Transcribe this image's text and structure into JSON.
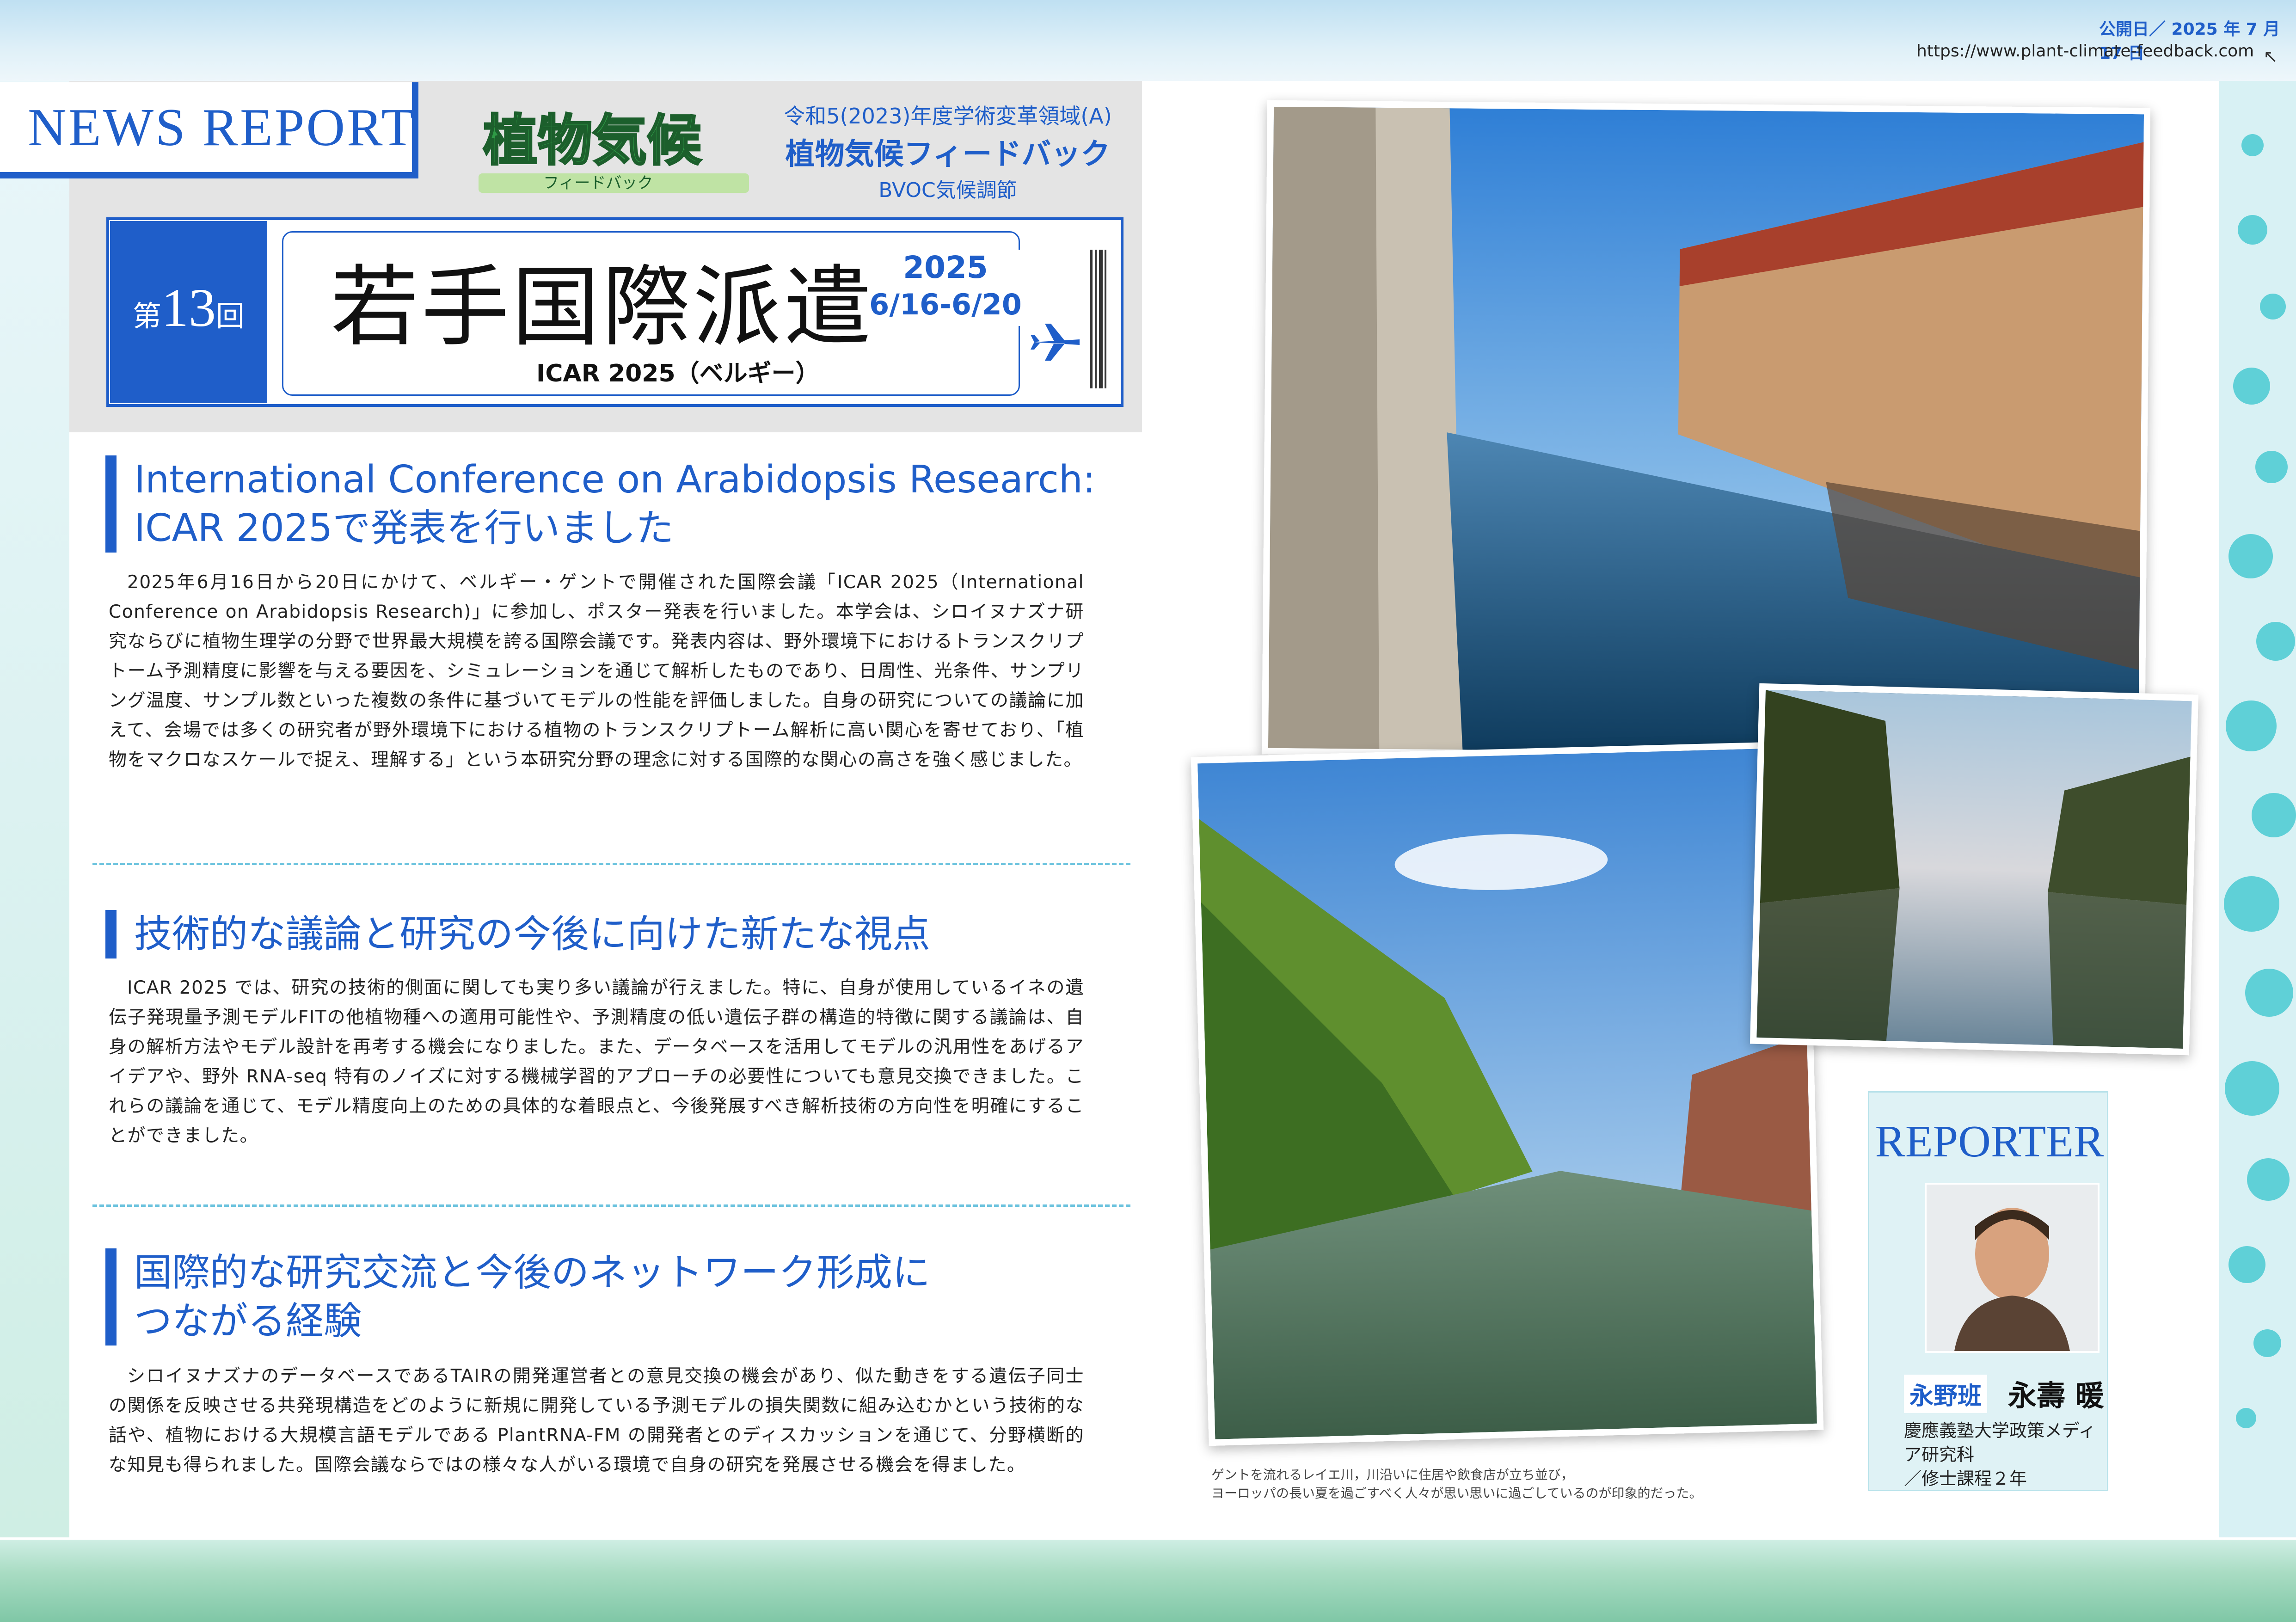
{
  "meta": {
    "published": "公開日／ 2025 年 7 月 17 日",
    "url": "https://www.plant-climate-feedback.com"
  },
  "header": {
    "news_report": "NEWS REPORT",
    "logo_text": "植物気候",
    "logo_subtext": "フィードバック",
    "grant_line": "令和5(2023)年度学術変革領域(A)",
    "project_name": "植物気候フィードバック",
    "project_sub": "BVOC気候調節",
    "issue_prefix": "第",
    "issue_number": "13",
    "issue_suffix": "回",
    "title": "若手国際派遣",
    "year": "2025",
    "dates": "6/16-6/20",
    "subtitle": "ICAR 2025（ベルギー）"
  },
  "sections": [
    {
      "heading_line1": "International Conference on Arabidopsis Research:",
      "heading_line2": "ICAR 2025で発表を行いました",
      "body": "2025年6月16日から20日にかけて、ベルギー・ゲントで開催された国際会議「ICAR 2025（International Conference on Arabidopsis Research)」に参加し、ポスター発表を行いました。本学会は、シロイヌナズナ研究ならびに植物生理学の分野で世界最大規模を誇る国際会議です。発表内容は、野外環境下におけるトランスクリプトーム予測精度に影響を与える要因を、シミュレーションを通じて解析したものであり、日周性、光条件、サンプリング温度、サンプル数といった複数の条件に基づいてモデルの性能を評価しました。自身の研究についての議論に加えて、会場では多くの研究者が野外環境下における植物のトランスクリプトーム解析に高い関心を寄せており、「植物をマクロなスケールで捉え、理解する」という本研究分野の理念に対する国際的な関心の高さを強く感じました。"
    },
    {
      "heading_line1": "技術的な議論と研究の今後に向けた新たな視点",
      "body": "ICAR 2025 では、研究の技術的側面に関しても実り多い議論が行えました。特に、自身が使用しているイネの遺伝子発現量予測モデルFITの他植物種への適用可能性や、予測精度の低い遺伝子群の構造的特徴に関する議論は、自身の解析方法やモデル設計を再考する機会になりました。また、データベースを活用してモデルの汎用性をあげるアイデアや、野外 RNA-seq 特有のノイズに対する機械学習的アプローチの必要性についても意見交換できました。これらの議論を通じて、モデル精度向上のための具体的な着眼点と、今後発展すべき解析技術の方向性を明確にすることができました。"
    },
    {
      "heading_line1": "国際的な研究交流と今後のネットワーク形成に",
      "heading_line2": "つながる経験",
      "body": "シロイヌナズナのデータベースであるTAIRの開発運営者との意見交換の機会があり、似た動きをする遺伝子同士の関係を反映させる共発現構造をどのように新規に開発している予測モデルの損失関数に組み込むかという技術的な話や、植物における大規模言語モデルである PlantRNA-FM の開発者とのディスカッションを通じて、分野横断的な知見も得られました。国際会議ならではの様々な人がいる環境で自身の研究を発展させる機会を得ました。"
    }
  ],
  "caption": {
    "line1": "ゲントを流れるレイエ川，川沿いに住居や飲食店が立ち並び，",
    "line2": "ヨーロッパの長い夏を過ごすべく人々が思い思いに過ごしているのが印象的だった。"
  },
  "reporter": {
    "label": "REPORTER",
    "lab": "永野班",
    "name": "永壽 暖",
    "affiliation_line1": "慶應義塾大学政策メディア研究科",
    "affiliation_line2": "／修士課程２年"
  },
  "colors": {
    "accent_blue": "#1f5ec9",
    "teal": "#5fd0d7"
  }
}
